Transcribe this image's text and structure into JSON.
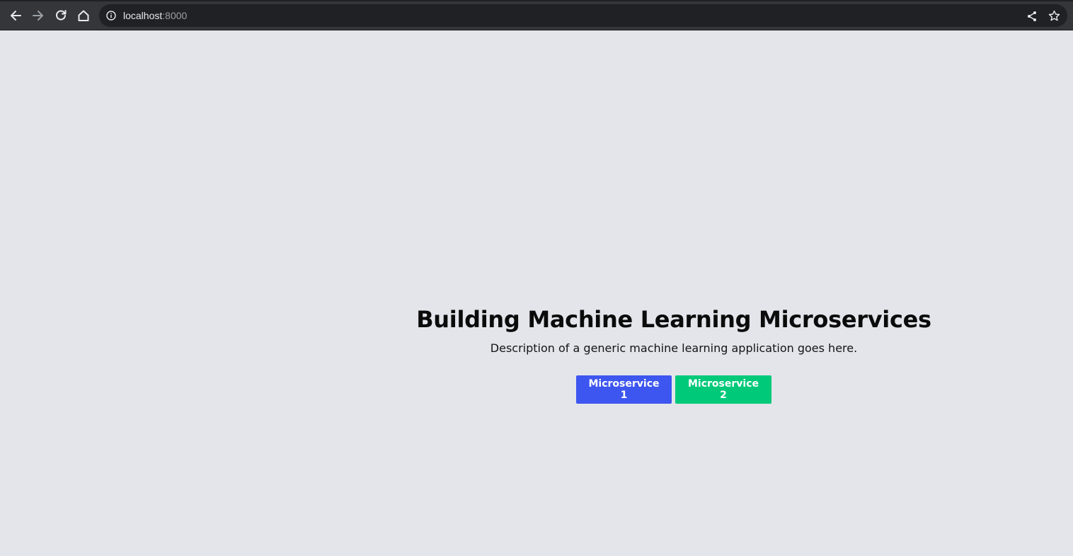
{
  "browser": {
    "url_host": "localhost",
    "url_port": ":8000",
    "icons": {
      "back": "arrow-left-icon",
      "forward": "arrow-right-icon",
      "reload": "reload-icon",
      "home": "home-icon",
      "site_info": "info-icon",
      "share": "share-icon",
      "bookmark": "star-icon"
    },
    "colors": {
      "toolbar": "#35363a",
      "omnibox": "#202124",
      "icon": "#e8eaed",
      "icon_disabled": "#9aa0a6"
    }
  },
  "page": {
    "background": "#e4e5ea",
    "title": "Building Machine Learning Microservices",
    "description": "Description of a generic machine learning application goes here.",
    "buttons": [
      {
        "label": "Microservice 1",
        "color": "#3e56f0"
      },
      {
        "label": "Microservice 2",
        "color": "#00c97a"
      }
    ]
  }
}
